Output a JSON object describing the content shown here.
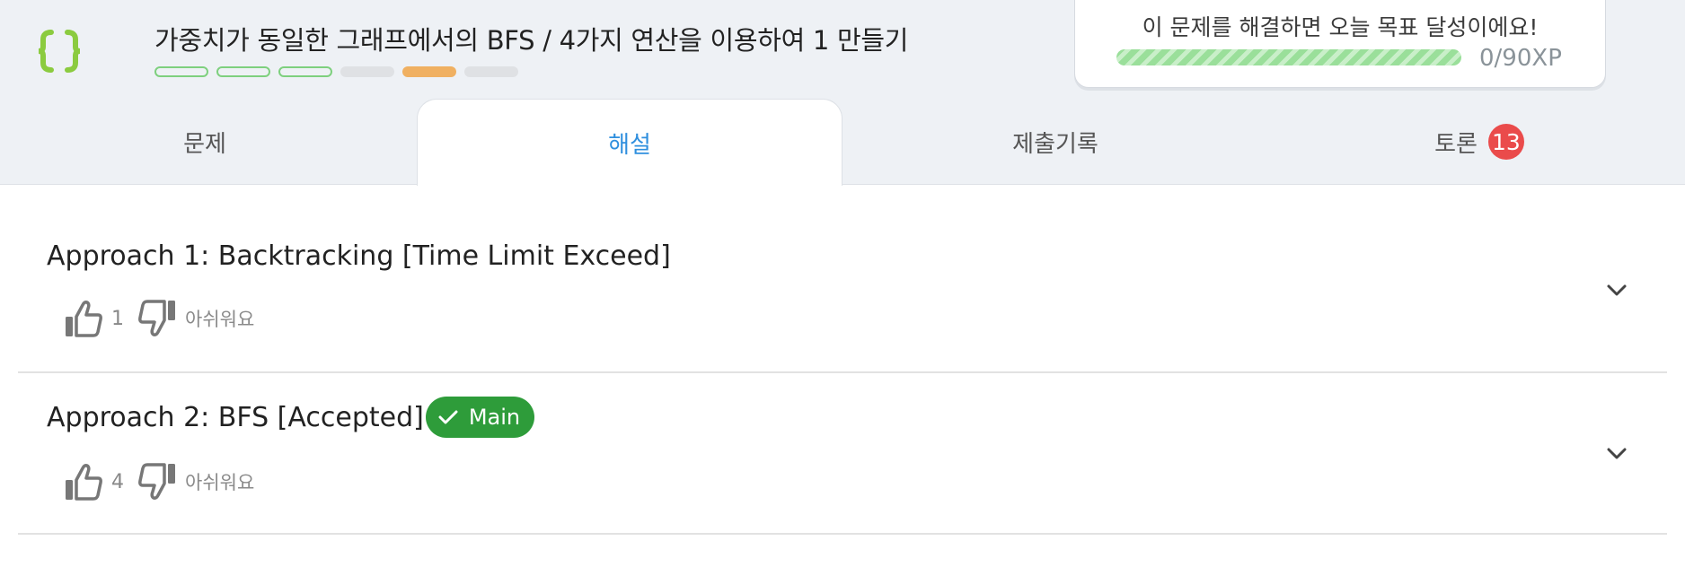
{
  "header": {
    "logo_icon": "braces-logo-icon",
    "title": "가중치가 동일한 그래프에서의 BFS / 4가지 연산을 이용하여 1 만들기",
    "steps": [
      "done",
      "done",
      "done",
      "pending",
      "current",
      "pending"
    ]
  },
  "goal": {
    "message": "이 문제를 해결하면 오늘 목표 달성이에요!",
    "progress": 0,
    "xp_label": "0/90XP"
  },
  "tabs": [
    {
      "label": "문제",
      "active": false
    },
    {
      "label": "해설",
      "active": true
    },
    {
      "label": "제출기록",
      "active": false
    },
    {
      "label": "토론",
      "active": false,
      "badge": "13"
    }
  ],
  "approaches": [
    {
      "title": "Approach 1: Backtracking [Time Limit Exceed]",
      "likes": "1",
      "dislike_label": "아쉬워요",
      "main": false
    },
    {
      "title": "Approach 2: BFS [Accepted]",
      "likes": "4",
      "dislike_label": "아쉬워요",
      "main": true,
      "main_label": "Main"
    }
  ],
  "colors": {
    "accent": "#2f8fde",
    "step_done": "#7ed07e",
    "step_current": "#f0b061",
    "badge": "#ea4b4b",
    "main_badge": "#2e9c3a",
    "logo": "#8bcb3f"
  }
}
